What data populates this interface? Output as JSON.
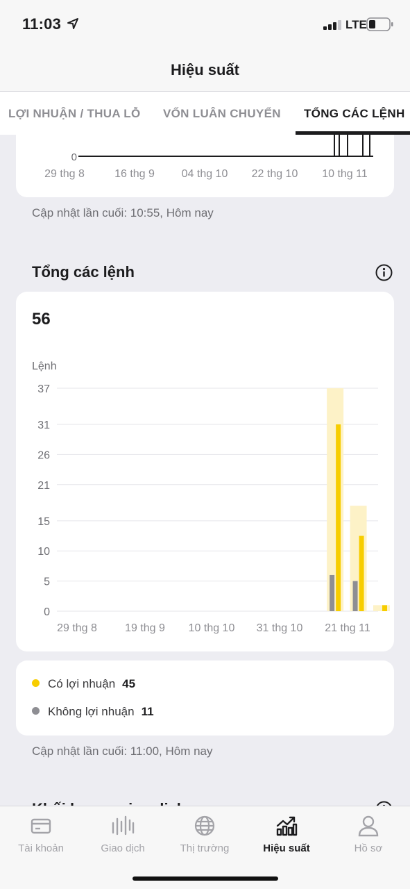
{
  "status_bar": {
    "time": "11:03",
    "network": "LTE"
  },
  "nav": {
    "title": "Hiệu suất"
  },
  "tabs": [
    {
      "label": "LỢI NHUẬN / THUA LỖ",
      "active": false
    },
    {
      "label": "VỐN LUÂN CHUYỂN",
      "active": false
    },
    {
      "label": "TỔNG CÁC LỆNH",
      "active": true
    }
  ],
  "top_chart": {
    "y_tick": "0",
    "x_labels": [
      "29 thg 8",
      "16 thg 9",
      "04 thg 10",
      "22 thg 10",
      "10 thg 11"
    ],
    "updated": "Cập nhật lần cuối: 10:55, Hôm nay"
  },
  "orders_section": {
    "title": "Tổng các lệnh",
    "total": "56",
    "y_unit": "Lệnh",
    "updated": "Cập nhật lần cuối: 11:00, Hôm nay"
  },
  "chart_data": {
    "type": "bar",
    "ylabel": "Lệnh",
    "yticks": [
      0,
      5,
      10,
      15,
      21,
      26,
      31,
      37
    ],
    "ylim": [
      0,
      37
    ],
    "x_labels": [
      "29 thg 8",
      "19 thg 9",
      "10 thg 10",
      "31 thg 10",
      "21 thg 11"
    ],
    "x_domain": [
      "2025-08-22",
      "2025-11-28"
    ],
    "groups": [
      {
        "date": "2025-11-14",
        "total": 37,
        "profit": 31,
        "no_profit": 6
      },
      {
        "date": "2025-11-21",
        "total": 17.5,
        "profit": 12.5,
        "no_profit": 5
      },
      {
        "date": "2025-11-28",
        "total": 1,
        "profit": 1,
        "no_profit": 0
      }
    ],
    "series": [
      {
        "name": "Có lợi nhuận",
        "color": "#f7cd00"
      },
      {
        "name": "Không lợi nhuận",
        "color": "#8e8e93"
      }
    ],
    "total_color": "#fdf2c7",
    "grid": true,
    "legend": "below"
  },
  "legend": [
    {
      "label": "Có lợi nhuận",
      "count": "45",
      "color": "#f7cd00"
    },
    {
      "label": "Không lợi nhuận",
      "count": "11",
      "color": "#8e8e93"
    }
  ],
  "next_section": {
    "title": "Khối lượng giao dịch"
  },
  "tabbar": [
    {
      "label": "Tài khoản",
      "icon": "card-icon",
      "active": false
    },
    {
      "label": "Giao dịch",
      "icon": "candles-icon",
      "active": false
    },
    {
      "label": "Thị trường",
      "icon": "globe-icon",
      "active": false
    },
    {
      "label": "Hiệu suất",
      "icon": "performance-chart-icon",
      "active": true
    },
    {
      "label": "Hồ sơ",
      "icon": "profile-icon",
      "active": false
    }
  ]
}
